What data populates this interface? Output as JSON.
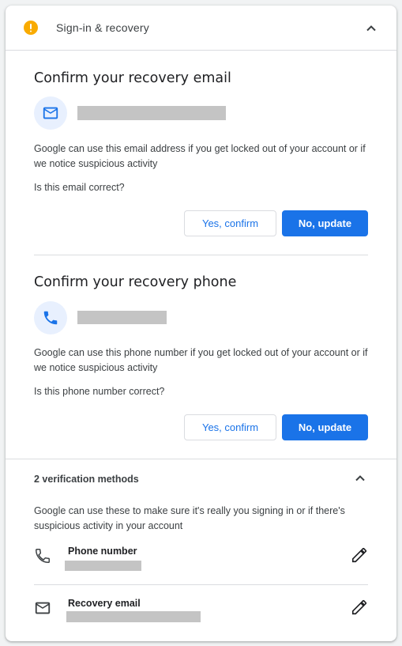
{
  "header": {
    "title": "Sign-in & recovery",
    "warning_icon": "warning-circle-icon",
    "collapse_icon": "chevron-up-icon"
  },
  "email_section": {
    "title": "Confirm your recovery email",
    "icon": "mail-icon",
    "description": "Google can use this email address if you get locked out of your account or if we notice suspicious activity",
    "question": "Is this email correct?",
    "confirm_label": "Yes, confirm",
    "update_label": "No, update"
  },
  "phone_section": {
    "title": "Confirm your recovery phone",
    "icon": "phone-icon",
    "description": "Google can use this phone number if you get locked out of your account or if we notice suspicious activity",
    "question": "Is this phone number correct?",
    "confirm_label": "Yes, confirm",
    "update_label": "No, update"
  },
  "verification": {
    "title": "2 verification methods",
    "description": "Google can use these to make sure it's really you signing in or if there's suspicious activity in your account",
    "items": [
      {
        "label": "Phone number",
        "icon": "phone-icon",
        "action_icon": "pencil-edit-icon"
      },
      {
        "label": "Recovery email",
        "icon": "mail-outline-icon",
        "action_icon": "pencil-edit-icon"
      }
    ]
  },
  "colors": {
    "accent": "#1a73e8",
    "warning": "#f9ab00",
    "avatar_bg": "#e8f0fe",
    "divider": "#dadce0"
  }
}
